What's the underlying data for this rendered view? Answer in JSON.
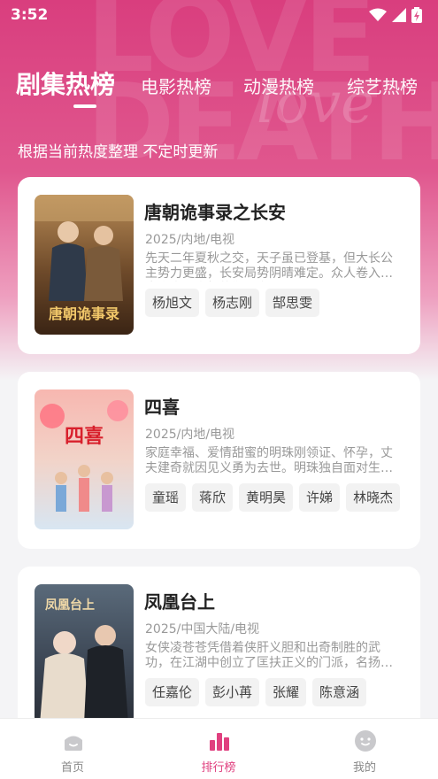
{
  "status": {
    "time": "3:52"
  },
  "tabs": [
    {
      "label": "剧集热榜",
      "active": true
    },
    {
      "label": "电影热榜",
      "active": false
    },
    {
      "label": "动漫热榜",
      "active": false
    },
    {
      "label": "综艺热榜",
      "active": false
    }
  ],
  "subtitle": "根据当前热度整理 不定时更新",
  "cards": [
    {
      "title": "唐朝诡事录之长安",
      "meta": "2025/内地/电视",
      "desc": "先天二年夏秋之交，天子虽已登基，但大长公主势力更盛，长安局势阴晴难定。众人卷入离奇诡事，真相扑朔迷离。",
      "poster_text": "唐朝诡事录",
      "tags": [
        "杨旭文",
        "杨志刚",
        "郜思雯"
      ]
    },
    {
      "title": "四喜",
      "meta": "2025/内地/电视",
      "desc": "家庭幸福、爱情甜蜜的明珠刚领证、怀孕，丈夫建奇就因见义勇为去世。明珠独自面对生活的种种考验。",
      "poster_text": "四喜",
      "tags": [
        "童瑶",
        "蒋欣",
        "黄明昊",
        "许娣",
        "林晓杰"
      ]
    },
    {
      "title": "凤凰台上",
      "meta": "2025/中国大陆/电视",
      "desc": "女侠凌苍苍凭借着侠肝义胆和出奇制胜的武功，在江湖中创立了匡扶正义的门派，名扬天下。",
      "poster_text": "凤凰台上",
      "tags": [
        "任嘉伦",
        "彭小苒",
        "张耀",
        "陈意涵"
      ]
    }
  ],
  "nav": [
    {
      "label": "首页",
      "icon": "home-icon",
      "active": false
    },
    {
      "label": "排行榜",
      "icon": "ranking-icon",
      "active": true
    },
    {
      "label": "我的",
      "icon": "profile-icon",
      "active": false
    }
  ],
  "colors": {
    "accent": "#e0407f",
    "hero": "#d93e7e"
  }
}
